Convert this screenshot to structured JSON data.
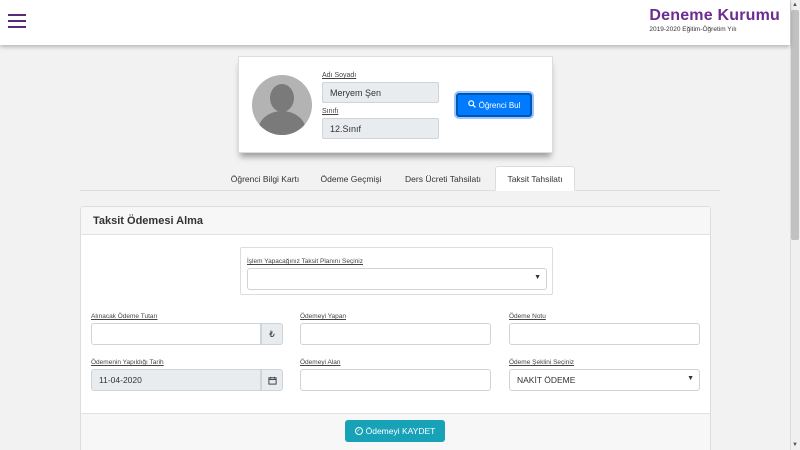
{
  "header": {
    "brand_title": "Deneme Kurumu",
    "brand_subtitle": "2019-2020 Eğitim-Öğretim Yılı"
  },
  "student": {
    "name_label": "Adı Soyadı",
    "name_value": "Meryem Şen",
    "class_label": "Sınıfı",
    "class_value": "12.Sınıf",
    "find_button": "Öğrenci Bul"
  },
  "tabs": [
    {
      "label": "Öğrenci Bilgi Kartı"
    },
    {
      "label": "Ödeme Geçmişi"
    },
    {
      "label": "Ders Ücreti Tahsilatı"
    },
    {
      "label": "Taksit Tahsilatı",
      "active": true
    }
  ],
  "panel": {
    "title": "Taksit Ödemesi Alma",
    "plan_label": "İşlem Yapacağınız Taksit Planını Seçiniz",
    "plan_value": "",
    "amount_label": "Alınacak Ödeme Tutarı",
    "amount_value": "",
    "currency_symbol": "₺",
    "payer_label": "Ödemeyi Yapan",
    "payer_value": "",
    "note_label": "Ödeme Notu",
    "note_value": "",
    "date_label": "Ödemenin Yapıldığı Tarih",
    "date_value": "11-04-2020",
    "receiver_label": "Ödemeyi Alan",
    "receiver_value": "",
    "method_label": "Ödeme Şeklini Seçiniz",
    "method_value": "NAKİT ÖDEME",
    "save_button": "Ödemeyi KAYDET"
  },
  "colors": {
    "brand": "#6b2c91",
    "primary": "#007bff",
    "info": "#17a2b8"
  }
}
